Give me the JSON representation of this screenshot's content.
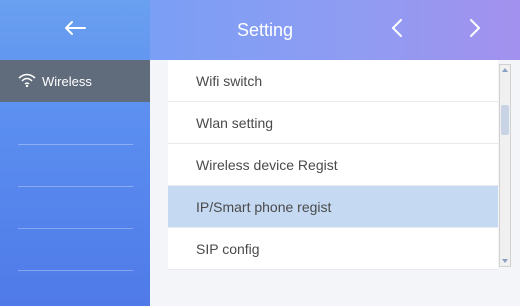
{
  "header": {
    "title": "Setting",
    "back_icon": "back-arrow-icon",
    "prev_icon": "chevron-left-icon",
    "next_icon": "chevron-right-icon"
  },
  "sidebar": {
    "items": [
      {
        "label": "Wireless",
        "icon": "wifi-icon",
        "active": true
      }
    ]
  },
  "menu": {
    "items": [
      {
        "label": "Wifi switch",
        "selected": false
      },
      {
        "label": "Wlan setting",
        "selected": false
      },
      {
        "label": "Wireless device Regist",
        "selected": false
      },
      {
        "label": "IP/Smart phone regist",
        "selected": true
      },
      {
        "label": "SIP config",
        "selected": false
      }
    ]
  },
  "colors": {
    "accent": "#5b8ef0",
    "selected_row": "#c5daf2",
    "active_sidebar": "#606c7c"
  }
}
